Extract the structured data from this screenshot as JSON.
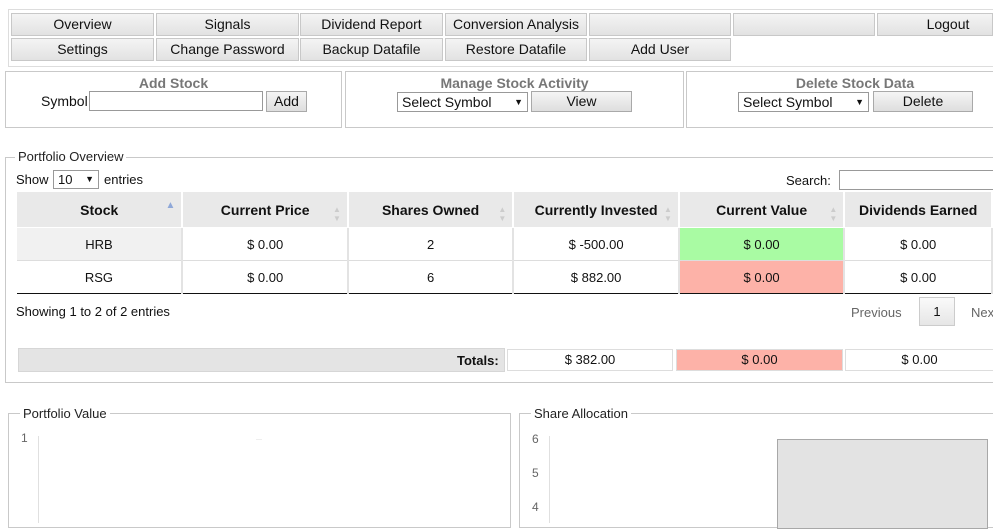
{
  "nav": {
    "row1": [
      "Overview",
      "Signals",
      "Dividend Report",
      "Conversion Analysis",
      "",
      "",
      "Logout"
    ],
    "row2": [
      "Settings",
      "Change Password",
      "Backup Datafile",
      "Restore Datafile",
      "Add User"
    ]
  },
  "add_stock": {
    "title": "Add Stock",
    "symbol_label": "Symbol",
    "symbol_value": "",
    "button": "Add"
  },
  "manage": {
    "title": "Manage Stock Activity",
    "select": "Select Symbol",
    "button": "View"
  },
  "delete": {
    "title": "Delete Stock Data",
    "select": "Select Symbol",
    "button": "Delete"
  },
  "portfolio": {
    "legend": "Portfolio Overview",
    "show_label": "Show",
    "entries_value": "10",
    "entries_label": "entries",
    "search_label": "Search:",
    "columns": [
      "Stock",
      "Current Price",
      "Shares Owned",
      "Currently Invested",
      "Current Value",
      "Dividends Earned"
    ],
    "rows": [
      [
        "HRB",
        "$ 0.00",
        "2",
        "$ -500.00",
        "$ 0.00",
        "$ 0.00"
      ],
      [
        "RSG",
        "$ 0.00",
        "6",
        "$ 882.00",
        "$ 0.00",
        "$ 0.00"
      ]
    ],
    "info": "Showing 1 to 2 of 2 entries",
    "prev": "Previous",
    "page": "1",
    "next": "Nex",
    "totals_label": "Totals:",
    "totals": [
      "$ 382.00",
      "$ 0.00",
      "$ 0.00"
    ]
  },
  "charts": {
    "portfolio_value": {
      "legend": "Portfolio Value",
      "y_tick": "1"
    },
    "share_allocation": {
      "legend": "Share Allocation",
      "y_ticks": [
        "6",
        "5",
        "4"
      ]
    }
  },
  "colors": {
    "positive": "#a9fba3",
    "negative": "#fdb2a8"
  }
}
